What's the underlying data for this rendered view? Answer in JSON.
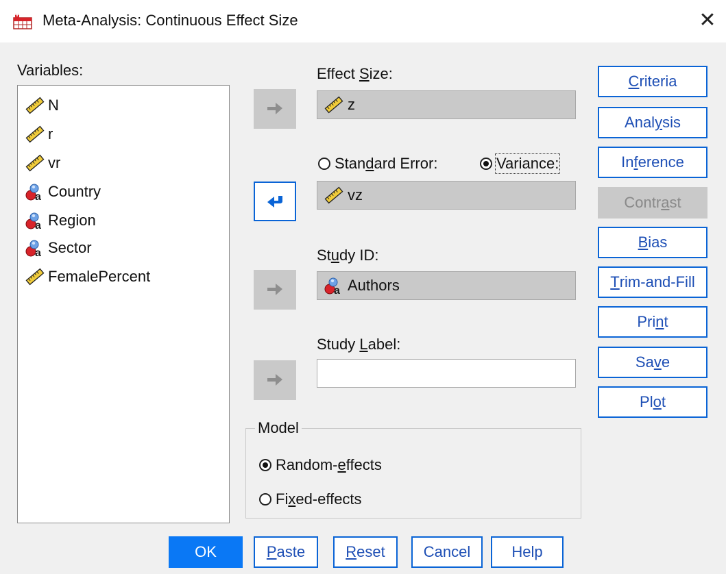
{
  "window": {
    "title": "Meta-Analysis: Continuous Effect Size",
    "close_glyph": "✕",
    "app_icon": "spss-dialog-icon"
  },
  "variables": {
    "label": "Variables:",
    "items": [
      {
        "name": "N",
        "icon": "scale-ruler-icon"
      },
      {
        "name": "r",
        "icon": "scale-ruler-icon"
      },
      {
        "name": "vr",
        "icon": "scale-ruler-icon"
      },
      {
        "name": "Country",
        "icon": "nominal-string-icon"
      },
      {
        "name": "Region",
        "icon": "nominal-string-icon"
      },
      {
        "name": "Sector",
        "icon": "nominal-string-icon"
      },
      {
        "name": "FemalePercent",
        "icon": "scale-ruler-icon"
      }
    ]
  },
  "effect_size": {
    "label_pre": "Effect ",
    "label_ul": "S",
    "label_post": "ize:",
    "value": "z",
    "icon": "scale-ruler-icon"
  },
  "error_type": {
    "se_pre": "Stan",
    "se_ul": "d",
    "se_post": "ard Error:",
    "var_label": "Variance:",
    "selected": "Variance",
    "value": "vz",
    "icon": "scale-ruler-icon"
  },
  "study_id": {
    "label_pre": "St",
    "label_ul": "u",
    "label_post": "dy ID:",
    "value": "Authors",
    "icon": "nominal-string-icon"
  },
  "study_label": {
    "label_pre": "Study ",
    "label_ul": "L",
    "label_post": "abel:",
    "value": ""
  },
  "model": {
    "legend": "Model",
    "random_pre": "Random-",
    "random_ul": "e",
    "random_post": "ffects",
    "fixed_pre": "Fi",
    "fixed_ul": "x",
    "fixed_post": "ed-effects",
    "selected": "Random-effects"
  },
  "side_buttons": {
    "criteria": {
      "pre": "",
      "ul": "C",
      "post": "riteria"
    },
    "analysis": {
      "pre": "Anal",
      "ul": "y",
      "post": "sis"
    },
    "inference": {
      "pre": "In",
      "ul": "f",
      "post": "erence"
    },
    "contrast": {
      "pre": "Contr",
      "ul": "a",
      "post": "st",
      "disabled": true
    },
    "bias": {
      "pre": "",
      "ul": "B",
      "post": "ias"
    },
    "trim": {
      "pre": "",
      "ul": "T",
      "post": "rim-and-Fill"
    },
    "print": {
      "pre": "Pri",
      "ul": "n",
      "post": "t"
    },
    "save": {
      "pre": "Sa",
      "ul": "v",
      "post": "e"
    },
    "plot": {
      "pre": "Pl",
      "ul": "o",
      "post": "t"
    }
  },
  "bottom_buttons": {
    "ok": "OK",
    "paste": {
      "pre": "",
      "ul": "P",
      "post": "aste"
    },
    "reset": {
      "pre": "",
      "ul": "R",
      "post": "eset"
    },
    "cancel": "Cancel",
    "help": "Help"
  },
  "colors": {
    "accent": "#0a64d6",
    "primary_button": "#0a78f5",
    "field_fill": "#c9c9c9",
    "dialog_bg": "#f0f0f0"
  }
}
